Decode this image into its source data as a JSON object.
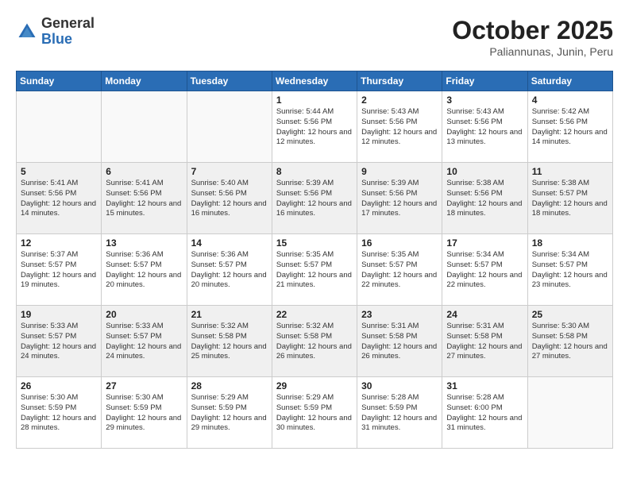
{
  "header": {
    "logo_general": "General",
    "logo_blue": "Blue",
    "title": "October 2025",
    "subtitle": "Paliannunas, Junin, Peru"
  },
  "weekdays": [
    "Sunday",
    "Monday",
    "Tuesday",
    "Wednesday",
    "Thursday",
    "Friday",
    "Saturday"
  ],
  "weeks": [
    [
      {
        "day": "",
        "info": ""
      },
      {
        "day": "",
        "info": ""
      },
      {
        "day": "",
        "info": ""
      },
      {
        "day": "1",
        "info": "Sunrise: 5:44 AM\nSunset: 5:56 PM\nDaylight: 12 hours\nand 12 minutes."
      },
      {
        "day": "2",
        "info": "Sunrise: 5:43 AM\nSunset: 5:56 PM\nDaylight: 12 hours\nand 12 minutes."
      },
      {
        "day": "3",
        "info": "Sunrise: 5:43 AM\nSunset: 5:56 PM\nDaylight: 12 hours\nand 13 minutes."
      },
      {
        "day": "4",
        "info": "Sunrise: 5:42 AM\nSunset: 5:56 PM\nDaylight: 12 hours\nand 14 minutes."
      }
    ],
    [
      {
        "day": "5",
        "info": "Sunrise: 5:41 AM\nSunset: 5:56 PM\nDaylight: 12 hours\nand 14 minutes."
      },
      {
        "day": "6",
        "info": "Sunrise: 5:41 AM\nSunset: 5:56 PM\nDaylight: 12 hours\nand 15 minutes."
      },
      {
        "day": "7",
        "info": "Sunrise: 5:40 AM\nSunset: 5:56 PM\nDaylight: 12 hours\nand 16 minutes."
      },
      {
        "day": "8",
        "info": "Sunrise: 5:39 AM\nSunset: 5:56 PM\nDaylight: 12 hours\nand 16 minutes."
      },
      {
        "day": "9",
        "info": "Sunrise: 5:39 AM\nSunset: 5:56 PM\nDaylight: 12 hours\nand 17 minutes."
      },
      {
        "day": "10",
        "info": "Sunrise: 5:38 AM\nSunset: 5:56 PM\nDaylight: 12 hours\nand 18 minutes."
      },
      {
        "day": "11",
        "info": "Sunrise: 5:38 AM\nSunset: 5:57 PM\nDaylight: 12 hours\nand 18 minutes."
      }
    ],
    [
      {
        "day": "12",
        "info": "Sunrise: 5:37 AM\nSunset: 5:57 PM\nDaylight: 12 hours\nand 19 minutes."
      },
      {
        "day": "13",
        "info": "Sunrise: 5:36 AM\nSunset: 5:57 PM\nDaylight: 12 hours\nand 20 minutes."
      },
      {
        "day": "14",
        "info": "Sunrise: 5:36 AM\nSunset: 5:57 PM\nDaylight: 12 hours\nand 20 minutes."
      },
      {
        "day": "15",
        "info": "Sunrise: 5:35 AM\nSunset: 5:57 PM\nDaylight: 12 hours\nand 21 minutes."
      },
      {
        "day": "16",
        "info": "Sunrise: 5:35 AM\nSunset: 5:57 PM\nDaylight: 12 hours\nand 22 minutes."
      },
      {
        "day": "17",
        "info": "Sunrise: 5:34 AM\nSunset: 5:57 PM\nDaylight: 12 hours\nand 22 minutes."
      },
      {
        "day": "18",
        "info": "Sunrise: 5:34 AM\nSunset: 5:57 PM\nDaylight: 12 hours\nand 23 minutes."
      }
    ],
    [
      {
        "day": "19",
        "info": "Sunrise: 5:33 AM\nSunset: 5:57 PM\nDaylight: 12 hours\nand 24 minutes."
      },
      {
        "day": "20",
        "info": "Sunrise: 5:33 AM\nSunset: 5:57 PM\nDaylight: 12 hours\nand 24 minutes."
      },
      {
        "day": "21",
        "info": "Sunrise: 5:32 AM\nSunset: 5:58 PM\nDaylight: 12 hours\nand 25 minutes."
      },
      {
        "day": "22",
        "info": "Sunrise: 5:32 AM\nSunset: 5:58 PM\nDaylight: 12 hours\nand 26 minutes."
      },
      {
        "day": "23",
        "info": "Sunrise: 5:31 AM\nSunset: 5:58 PM\nDaylight: 12 hours\nand 26 minutes."
      },
      {
        "day": "24",
        "info": "Sunrise: 5:31 AM\nSunset: 5:58 PM\nDaylight: 12 hours\nand 27 minutes."
      },
      {
        "day": "25",
        "info": "Sunrise: 5:30 AM\nSunset: 5:58 PM\nDaylight: 12 hours\nand 27 minutes."
      }
    ],
    [
      {
        "day": "26",
        "info": "Sunrise: 5:30 AM\nSunset: 5:59 PM\nDaylight: 12 hours\nand 28 minutes."
      },
      {
        "day": "27",
        "info": "Sunrise: 5:30 AM\nSunset: 5:59 PM\nDaylight: 12 hours\nand 29 minutes."
      },
      {
        "day": "28",
        "info": "Sunrise: 5:29 AM\nSunset: 5:59 PM\nDaylight: 12 hours\nand 29 minutes."
      },
      {
        "day": "29",
        "info": "Sunrise: 5:29 AM\nSunset: 5:59 PM\nDaylight: 12 hours\nand 30 minutes."
      },
      {
        "day": "30",
        "info": "Sunrise: 5:28 AM\nSunset: 5:59 PM\nDaylight: 12 hours\nand 31 minutes."
      },
      {
        "day": "31",
        "info": "Sunrise: 5:28 AM\nSunset: 6:00 PM\nDaylight: 12 hours\nand 31 minutes."
      },
      {
        "day": "",
        "info": ""
      }
    ]
  ]
}
